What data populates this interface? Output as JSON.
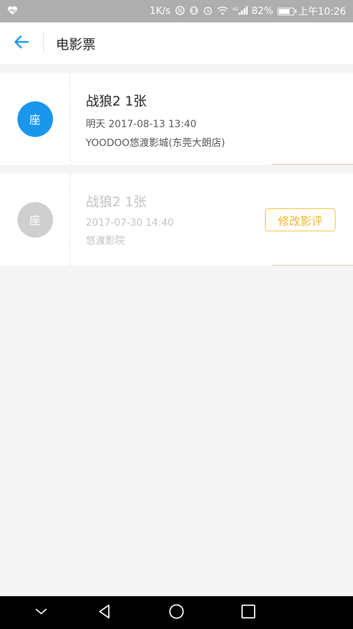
{
  "status_bar": {
    "speed": "1K/s",
    "battery_percent": "82%",
    "battery_level": 0.82,
    "time": "上午10:26",
    "icons": [
      "heart-monitor-icon",
      "nfc-icon",
      "vibrate-icon",
      "alarm-icon",
      "wifi-icon",
      "signal-icon",
      "battery-icon"
    ]
  },
  "header": {
    "title": "电影票",
    "back_icon": "arrow-left-icon"
  },
  "tickets": [
    {
      "seat_label": "座",
      "title": "战狼2 1张",
      "time": "明天 2017-08-13 13:40",
      "cinema": "YOODOO悠渡影城(东莞大朗店)",
      "status": "upcoming",
      "seat_color": "#1a97ed"
    },
    {
      "seat_label": "座",
      "title": "战狼2 1张",
      "time": "2017-07-30 14:40",
      "cinema": "悠渡影院",
      "status": "past",
      "seat_color": "#cfcfcf",
      "action_label": "修改影评"
    }
  ],
  "colors": {
    "accent_blue": "#1a97ed",
    "review_yellow": "#f5c33b"
  }
}
